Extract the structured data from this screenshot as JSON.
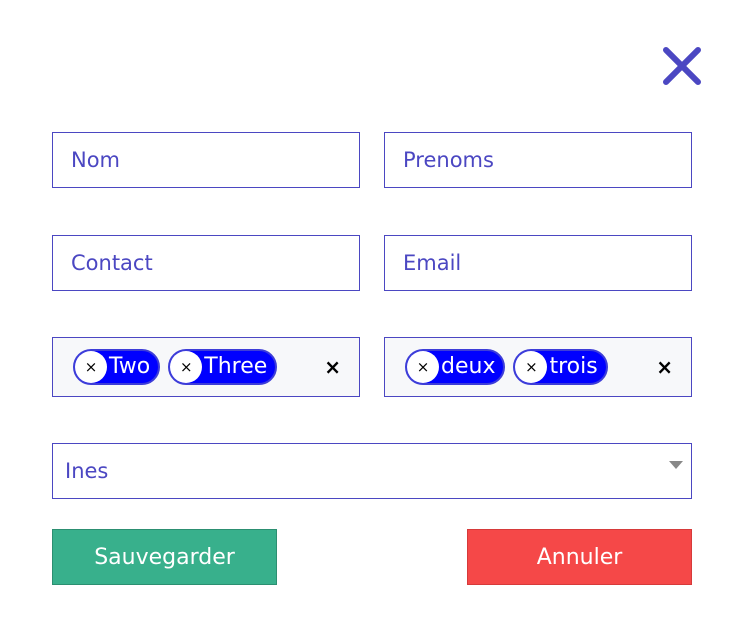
{
  "form": {
    "close_icon": "close-icon",
    "fields": {
      "nom": {
        "placeholder": "Nom",
        "value": ""
      },
      "prenoms": {
        "placeholder": "Prenoms",
        "value": ""
      },
      "contact": {
        "placeholder": "Contact",
        "value": ""
      },
      "email": {
        "placeholder": "Email",
        "value": ""
      }
    },
    "tags_left": {
      "items": [
        {
          "label": "Two",
          "remove": "×"
        },
        {
          "label": "Three",
          "remove": "×"
        }
      ],
      "clear": "×"
    },
    "tags_right": {
      "items": [
        {
          "label": "deux",
          "remove": "×"
        },
        {
          "label": "trois",
          "remove": "×"
        }
      ],
      "clear": "×"
    },
    "select": {
      "value": "Ines"
    },
    "buttons": {
      "save_label": "Sauvegarder",
      "cancel_label": "Annuler"
    }
  },
  "colors": {
    "accent": "#4b47c2",
    "tag": "#0000ff",
    "save": "#38b08c",
    "cancel": "#f54848"
  }
}
